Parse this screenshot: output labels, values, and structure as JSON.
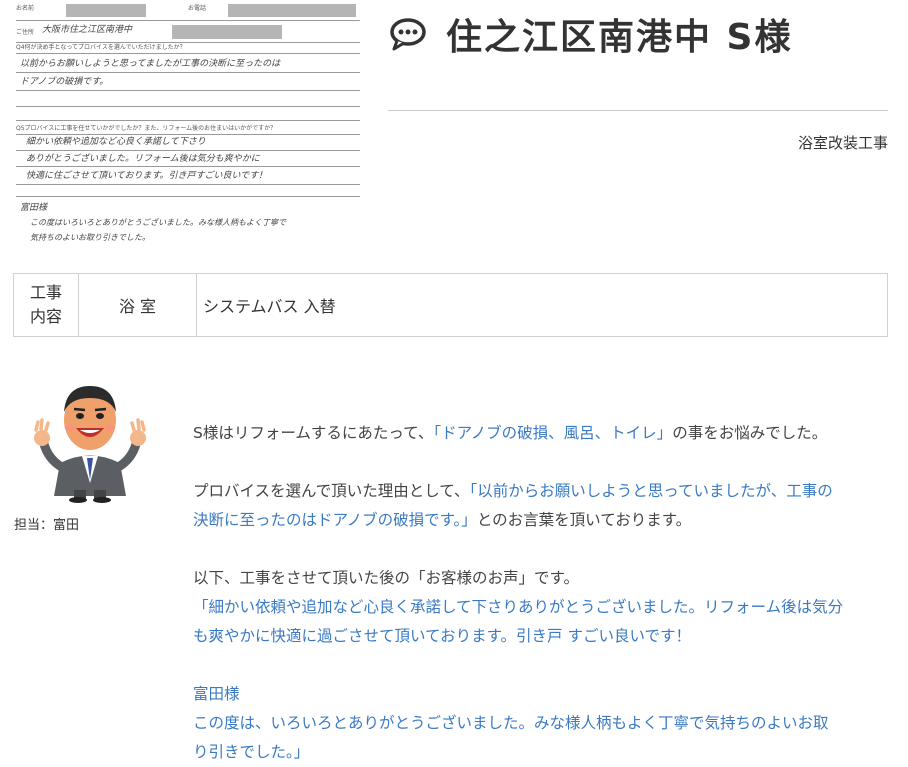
{
  "form": {
    "label_name": "お名前",
    "label_phone": "お電話",
    "label_address": "ご住所",
    "address_hand": "大阪市住之江区南港中",
    "q1_label": "Q4何が決め手となってプロバイスを選んでいただけましたか？",
    "q1_answer_line1": "以前からお願いしようと思ってましたが工事の決断に至ったのは",
    "q1_answer_line2": "ドアノブの破損です。",
    "q2_label": "Q5プロバイスに工事を任せていかがでしたか？また、リフォーム後のお住まいはいかがですか？",
    "q2_answer_line1": "細かい依頼や追加など心良く承諾して下さり",
    "q2_answer_line2": "ありがとうございました。リフォーム後は気分も爽やかに",
    "q2_answer_line3": "快適に住ごさせて頂いております。引き戸すごい良いです！",
    "staff_hand": "富田様",
    "staff_line1": "この度はいろいろとありがとうございました。みな様人柄もよく丁寧で",
    "staff_line2": "気持ちのよいお取り引きでした。"
  },
  "header": {
    "title": "住之江区南港中 S様",
    "icon": "speech-bubble-icon",
    "category": "浴室改装工事"
  },
  "work_table": {
    "key_line1": "工事",
    "key_line2": "内容",
    "category": "浴 室",
    "value": "システムバス 入替"
  },
  "staff": {
    "caption": "担当：富田",
    "icon": "staff-illustration"
  },
  "body": {
    "p1_a": "S様はリフォームするにあたって、",
    "p1_b": "「ドアノブの破損、風呂、トイレ」",
    "p1_c": "の事をお悩みでした。",
    "p2_a": "プロバイスを選んで頂いた理由として、",
    "p2_b": "「以前からお願いしようと思っていましたが、工事の",
    "p2_c": "決断に至ったのはドアノブの破損です。」",
    "p2_d": "とのお言葉を頂いております。",
    "p3_a": "以下、工事をさせて頂いた後の「お客様のお声」です。",
    "p3_b": "「細かい依頼や追加など心良く承諾して下さりありがとうございました。リフォーム後は気分",
    "p3_c": "も爽やかに快適に過ごさせて頂いております。引き戸 すごい良いです！",
    "p4_a": "富田様",
    "p4_b": "この度は、いろいろとありがとうございました。みな様人柄もよく丁寧で気持ちのよいお取",
    "p4_c": "り引きでした。」"
  },
  "colors": {
    "accent_blue": "#3a7ac4",
    "text": "#333333"
  }
}
